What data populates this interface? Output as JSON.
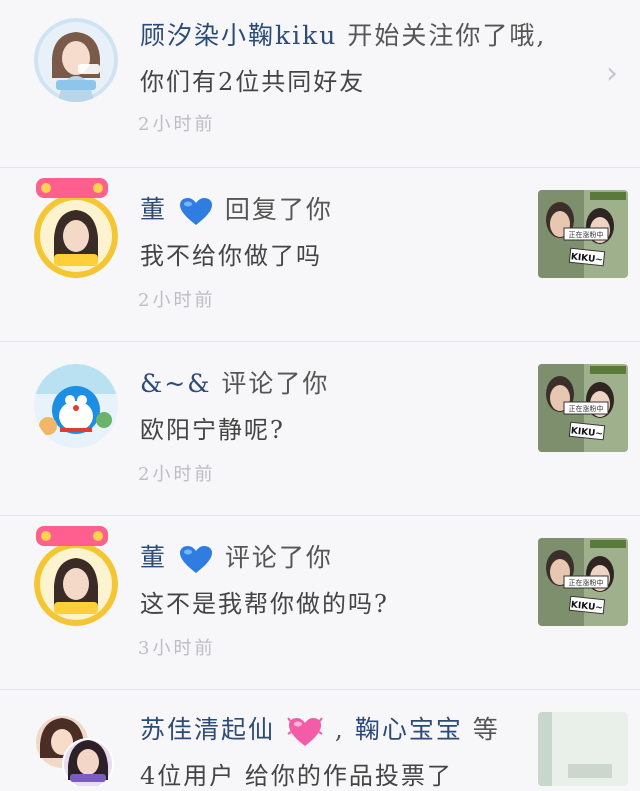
{
  "notifications": [
    {
      "name": "顾汐染小鞠kiku",
      "action": "开始关注你了哦,",
      "line2": "你们有2位共同好友",
      "time": "2小时前"
    },
    {
      "name": "董",
      "action": "回复了你",
      "line2": "我不给你做了吗",
      "time": "2小时前",
      "thumb_badge": "正在涨粉中",
      "thumb_tag": "KIKU~"
    },
    {
      "name": "&~&",
      "action": "评论了你",
      "line2": "欧阳宁静呢?",
      "time": "2小时前",
      "thumb_badge": "正在涨粉中",
      "thumb_tag": "KIKU~"
    },
    {
      "name": "董",
      "action": "评论了你",
      "line2": "这不是我帮你做的吗?",
      "time": "3小时前",
      "thumb_badge": "正在涨粉中",
      "thumb_tag": "KIKU~"
    },
    {
      "name": "苏佳清起仙",
      "name2": "鞠心宝宝",
      "action": "等",
      "line2": "4位用户 给你的作品投票了"
    }
  ],
  "icons": {
    "chevron": "chevron-right-icon",
    "heart_blue": "blue-heart-icon",
    "heart_pink": "sparkling-heart-icon"
  },
  "colors": {
    "name": "#2d4b78",
    "time": "#bdbdc3",
    "background": "#f7f7f9"
  }
}
